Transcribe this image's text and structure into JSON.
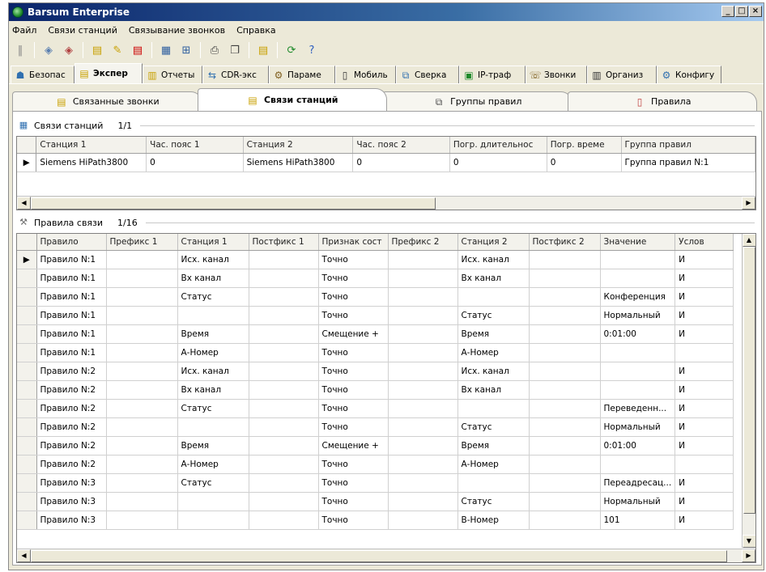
{
  "window": {
    "title": "Barsum Enterprise",
    "buttons": [
      "_",
      "□",
      "×"
    ]
  },
  "menu": [
    "Файл",
    "Связи станций",
    "Связывание звонков",
    "Справка"
  ],
  "toolbar_icons": [
    "pause-icon",
    "wizard-icon",
    "wizard-edit-icon",
    "station-icon",
    "station-edit-icon",
    "station-delete-icon",
    "table-icon",
    "table-add-icon",
    "print-icon",
    "copy-icon",
    "report-icon",
    "refresh-icon",
    "help-icon"
  ],
  "module_tabs": [
    {
      "label": "Безопас",
      "icon": "security-icon"
    },
    {
      "label": "Экспер",
      "icon": "expert-icon",
      "active": true
    },
    {
      "label": "Отчеты",
      "icon": "reports-icon"
    },
    {
      "label": "CDR-экс",
      "icon": "cdr-icon"
    },
    {
      "label": "Параме",
      "icon": "params-icon"
    },
    {
      "label": "Мобиль",
      "icon": "mobile-icon"
    },
    {
      "label": "Сверка",
      "icon": "reconcile-icon"
    },
    {
      "label": "IP-траф",
      "icon": "ip-icon"
    },
    {
      "label": "Звонки",
      "icon": "calls-icon"
    },
    {
      "label": "Организ",
      "icon": "org-icon"
    },
    {
      "label": "Конфигу",
      "icon": "config-icon"
    }
  ],
  "sub_tabs": [
    {
      "label": "Связанные звонки",
      "icon": "linked-calls-icon"
    },
    {
      "label": "Связи станций",
      "icon": "station-links-icon",
      "active": true
    },
    {
      "label": "Группы правил",
      "icon": "rule-groups-icon"
    },
    {
      "label": "Правила",
      "icon": "rules-icon"
    }
  ],
  "stations_section": {
    "title": "Связи станций",
    "count": "1/1"
  },
  "stations_table": {
    "columns": [
      "Станция 1",
      "Час. пояс 1",
      "Станция 2",
      "Час. пояс 2",
      "Погр. длительнос",
      "Погр. време",
      "Группа правил"
    ],
    "rows": [
      [
        "Siemens HiPath3800",
        "0",
        "Siemens HiPath3800",
        "0",
        "0",
        "0",
        "Группа правил N:1"
      ]
    ]
  },
  "rules_section": {
    "title": "Правила связи",
    "count": "1/16"
  },
  "rules_table": {
    "columns": [
      "Правило",
      "Префикс 1",
      "Станция 1",
      "Постфикс 1",
      "Признак сост",
      "Префикс 2",
      "Станция 2",
      "Постфикс 2",
      "Значение",
      "Услов"
    ],
    "rows": [
      [
        "Правило N:1",
        "",
        "Исх. канал",
        "",
        "Точно",
        "",
        "Исх. канал",
        "",
        "",
        "И"
      ],
      [
        "Правило N:1",
        "",
        "Вх канал",
        "",
        "Точно",
        "",
        "Вх канал",
        "",
        "",
        "И"
      ],
      [
        "Правило N:1",
        "",
        "Статус",
        "",
        "Точно",
        "",
        "",
        "",
        "Конференция",
        "И"
      ],
      [
        "Правило N:1",
        "",
        "",
        "",
        "Точно",
        "",
        "Статус",
        "",
        "Нормальный",
        "И"
      ],
      [
        "Правило N:1",
        "",
        "Время",
        "",
        "Смещение +",
        "",
        "Время",
        "",
        "0:01:00",
        "И"
      ],
      [
        "Правило N:1",
        "",
        "А-Номер",
        "",
        "Точно",
        "",
        "А-Номер",
        "",
        "",
        ""
      ],
      [
        "Правило N:2",
        "",
        "Исх. канал",
        "",
        "Точно",
        "",
        "Исх. канал",
        "",
        "",
        "И"
      ],
      [
        "Правило N:2",
        "",
        "Вх канал",
        "",
        "Точно",
        "",
        "Вх канал",
        "",
        "",
        "И"
      ],
      [
        "Правило N:2",
        "",
        "Статус",
        "",
        "Точно",
        "",
        "",
        "",
        "Переведенн...",
        "И"
      ],
      [
        "Правило N:2",
        "",
        "",
        "",
        "Точно",
        "",
        "Статус",
        "",
        "Нормальный",
        "И"
      ],
      [
        "Правило N:2",
        "",
        "Время",
        "",
        "Смещение +",
        "",
        "Время",
        "",
        "0:01:00",
        "И"
      ],
      [
        "Правило N:2",
        "",
        "А-Номер",
        "",
        "Точно",
        "",
        "А-Номер",
        "",
        "",
        ""
      ],
      [
        "Правило N:3",
        "",
        "Статус",
        "",
        "Точно",
        "",
        "",
        "",
        "Переадресац...",
        "И"
      ],
      [
        "Правило N:3",
        "",
        "",
        "",
        "Точно",
        "",
        "Статус",
        "",
        "Нормальный",
        "И"
      ],
      [
        "Правило N:3",
        "",
        "",
        "",
        "Точно",
        "",
        "В-Номер",
        "",
        "101",
        "И"
      ]
    ]
  }
}
